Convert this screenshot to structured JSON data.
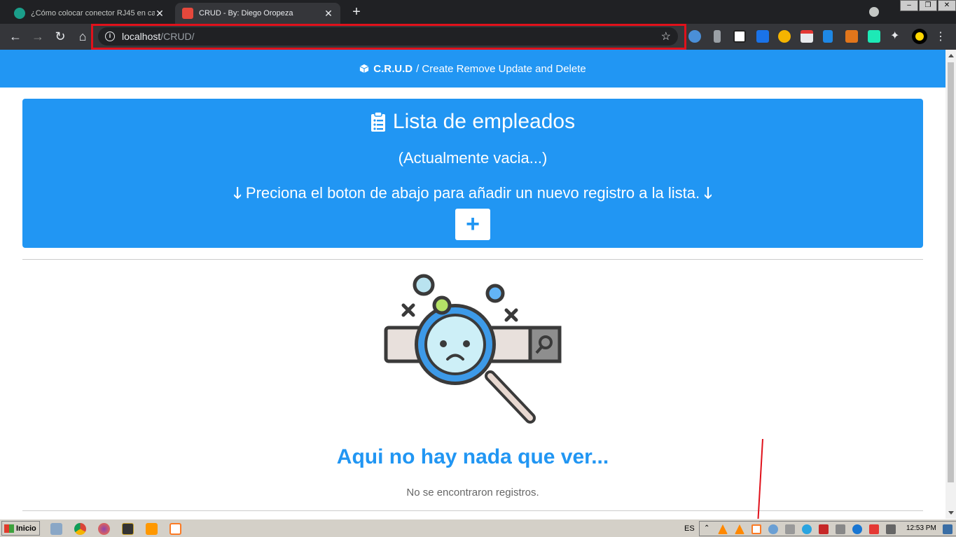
{
  "browser": {
    "tabs": [
      {
        "title": "¿Cómo colocar conector RJ45 en ca",
        "active": false
      },
      {
        "title": "CRUD - By: Diego Oropeza",
        "active": true
      }
    ],
    "url_host": "localhost",
    "url_path": "/CRUD/",
    "new_tab_label": "+"
  },
  "app": {
    "brand": "C.R.U.D",
    "tagline": "/ Create Remove Update and Delete"
  },
  "hero": {
    "title": "Lista de empleados",
    "subtitle": "(Actualmente vacia...)",
    "hint": "Preciona el boton de abajo para añadir un nuevo registro a la lista.",
    "add_label": "+"
  },
  "empty_state": {
    "title": "Aqui no hay nada que ver...",
    "message": "No se encontraron registros."
  },
  "taskbar": {
    "start_label": "Inicio",
    "language": "ES",
    "clock": "12:53 PM"
  },
  "colors": {
    "primary": "#2196f3",
    "highlight": "#e0111b",
    "browser_dark": "#202124"
  }
}
